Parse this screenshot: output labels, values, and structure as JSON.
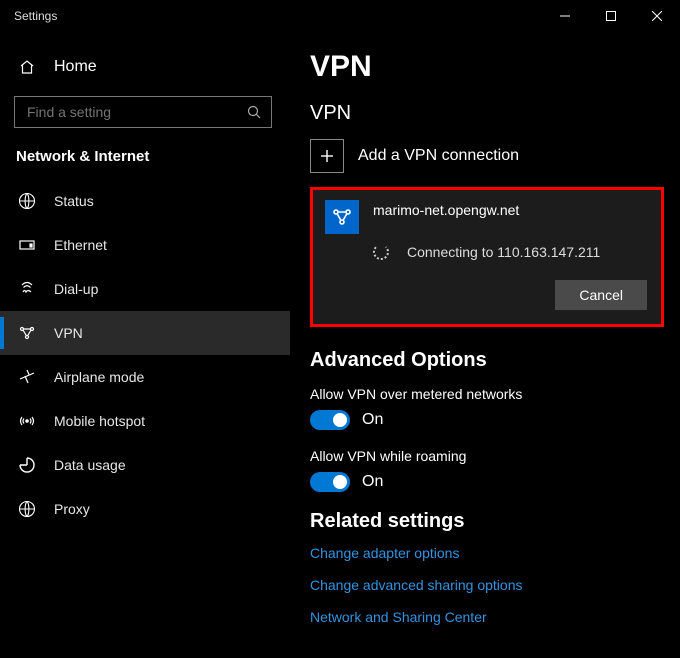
{
  "window": {
    "title": "Settings"
  },
  "sidebar": {
    "home": "Home",
    "search_placeholder": "Find a setting",
    "section": "Network & Internet",
    "items": [
      {
        "label": "Status"
      },
      {
        "label": "Ethernet"
      },
      {
        "label": "Dial-up"
      },
      {
        "label": "VPN"
      },
      {
        "label": "Airplane mode"
      },
      {
        "label": "Mobile hotspot"
      },
      {
        "label": "Data usage"
      },
      {
        "label": "Proxy"
      }
    ],
    "active_index": 3
  },
  "main": {
    "title": "VPN",
    "section": "VPN",
    "add_label": "Add a VPN connection",
    "connection": {
      "name": "marimo-net.opengw.net",
      "status": "Connecting to 110.163.147.211",
      "cancel": "Cancel"
    },
    "advanced": {
      "title": "Advanced Options",
      "metered_label": "Allow VPN over metered networks",
      "metered_state": "On",
      "roaming_label": "Allow VPN while roaming",
      "roaming_state": "On"
    },
    "related": {
      "title": "Related settings",
      "links": [
        "Change adapter options",
        "Change advanced sharing options",
        "Network and Sharing Center"
      ]
    }
  }
}
